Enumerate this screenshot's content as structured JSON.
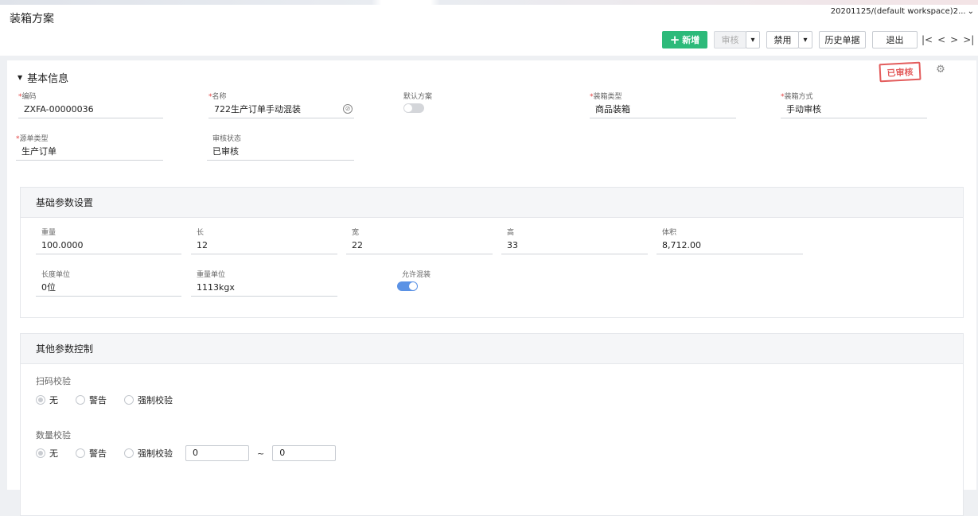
{
  "header": {
    "title": "装箱方案",
    "workspace": "20201125/(default workspace)2..."
  },
  "toolbar": {
    "add_label": "新增",
    "audit_label": "审核",
    "disable_label": "禁用",
    "history_label": "历史单据",
    "exit_label": "退出"
  },
  "basic_info": {
    "section_title": "基本信息",
    "stamp_text": "已审核",
    "fields": {
      "code": {
        "label": "编码",
        "value": "ZXFA-00000036",
        "required": true
      },
      "name": {
        "label": "名称",
        "value": "722生产订单手动混装",
        "required": true
      },
      "default_plan": {
        "label": "默认方案",
        "checked": false
      },
      "packing_type": {
        "label": "装箱类型",
        "value": "商品装箱",
        "required": true
      },
      "packing_method": {
        "label": "装箱方式",
        "value": "手动审核",
        "required": true
      },
      "source_type": {
        "label": "源单类型",
        "value": "生产订单",
        "required": true
      },
      "audit_status": {
        "label": "审核状态",
        "value": "已审核"
      }
    }
  },
  "basic_params": {
    "panel_title": "基础参数设置",
    "fields": {
      "weight": {
        "label": "重量",
        "value": "100.0000"
      },
      "length": {
        "label": "长",
        "value": "12"
      },
      "width": {
        "label": "宽",
        "value": "22"
      },
      "height": {
        "label": "高",
        "value": "33"
      },
      "volume": {
        "label": "体积",
        "value": "8,712.00"
      },
      "length_unit": {
        "label": "长度单位",
        "value": "0位"
      },
      "weight_unit": {
        "label": "重量单位",
        "value": "1113kgx"
      },
      "allow_mixed": {
        "label": "允许混装",
        "checked": true
      }
    }
  },
  "other_params": {
    "panel_title": "其他参数控制",
    "scan_check": {
      "label": "扫码校验",
      "options": [
        "无",
        "警告",
        "强制校验"
      ],
      "selected": "无"
    },
    "qty_check": {
      "label": "数量校验",
      "options": [
        "无",
        "警告",
        "强制校验"
      ],
      "selected": "无",
      "min": "0",
      "max": "0",
      "separator": "~"
    }
  },
  "colors": {
    "primary": "#2dba7a",
    "required": "#e34040",
    "stamp": "#e35c5c",
    "toggle_on": "#5b92e5"
  }
}
